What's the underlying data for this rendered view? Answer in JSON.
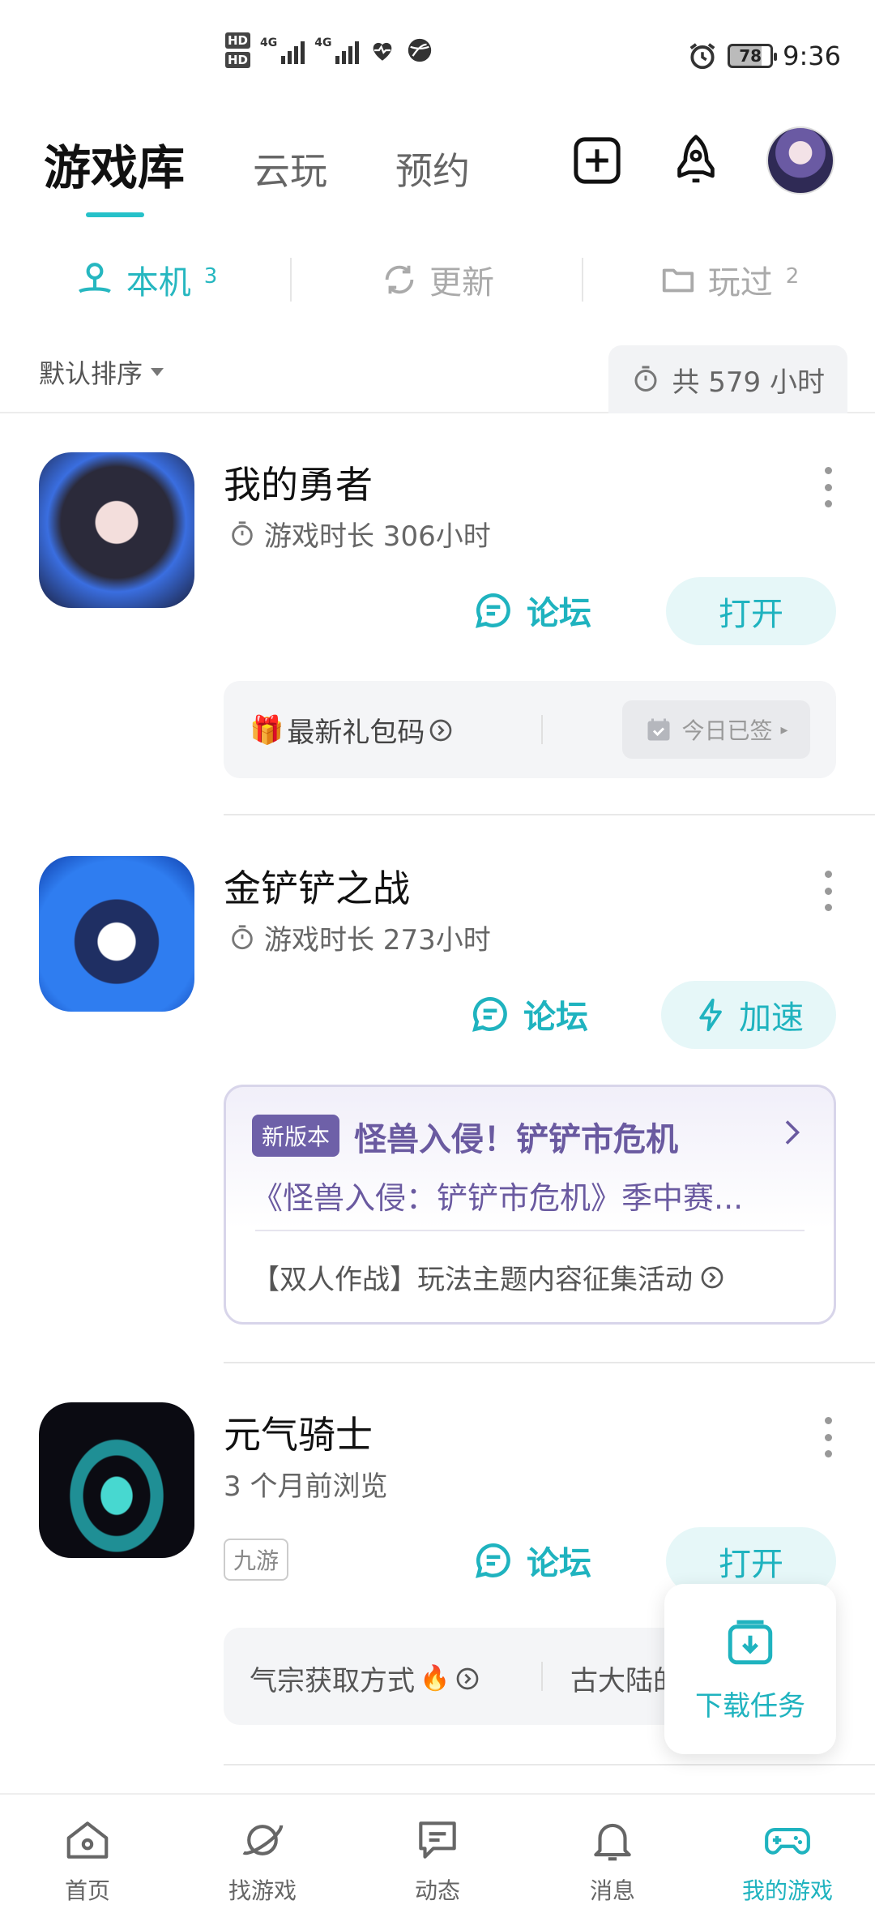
{
  "status_bar": {
    "hd1": "HD",
    "hd2": "HD",
    "net1": "4G",
    "net2": "4G",
    "battery": "78",
    "time": "9:36"
  },
  "header": {
    "tabs": [
      {
        "label": "游戏库"
      },
      {
        "label": "云玩"
      },
      {
        "label": "预约"
      }
    ]
  },
  "segments": [
    {
      "label": "本机",
      "count": "3"
    },
    {
      "label": "更新",
      "count": ""
    },
    {
      "label": "玩过",
      "count": "2"
    }
  ],
  "sort": {
    "label": "默认排序",
    "total": "共 579 小时"
  },
  "games": [
    {
      "title": "我的勇者",
      "subtitle": "游戏时长 306小时",
      "forum_label": "论坛",
      "action_label": "打开",
      "gift_label": "最新礼包码",
      "signed_label": "今日已签"
    },
    {
      "title": "金铲铲之战",
      "subtitle": "游戏时长 273小时",
      "forum_label": "论坛",
      "action_label": "加速",
      "news_tag": "新版本",
      "news_title": "怪兽入侵！铲铲市危机",
      "news_desc": "《怪兽入侵：铲铲市危机》季中赛...",
      "news_event": "【双人作战】玩法主题内容征集活动"
    },
    {
      "title": "元气骑士",
      "subtitle": "3 个月前浏览",
      "source_tag": "九游",
      "forum_label": "论坛",
      "action_label": "打开",
      "tip_left": "气宗获取方式",
      "tip_right": "古大陆的"
    }
  ],
  "float_button": {
    "label": "下载任务"
  },
  "bottom_nav": [
    {
      "label": "首页",
      "icon": "home-icon"
    },
    {
      "label": "找游戏",
      "icon": "planet-icon"
    },
    {
      "label": "动态",
      "icon": "chat-icon"
    },
    {
      "label": "消息",
      "icon": "bell-icon"
    },
    {
      "label": "我的游戏",
      "icon": "gamepad-icon"
    }
  ],
  "colors": {
    "accent": "#1fb3bf",
    "news_purple": "#6e60a8"
  }
}
